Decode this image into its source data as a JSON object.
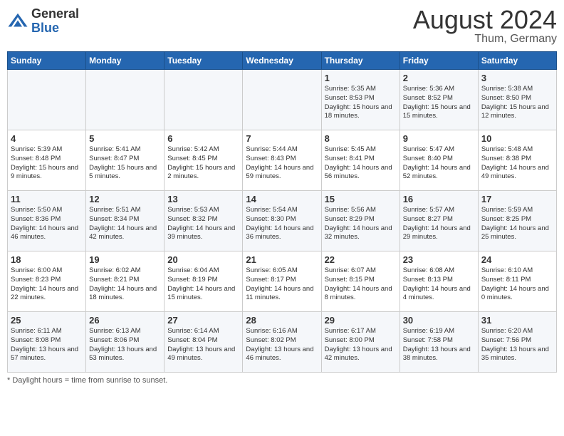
{
  "header": {
    "logo_general": "General",
    "logo_blue": "Blue",
    "month_year": "August 2024",
    "location": "Thum, Germany"
  },
  "footer": {
    "note": "Daylight hours"
  },
  "days_of_week": [
    "Sunday",
    "Monday",
    "Tuesday",
    "Wednesday",
    "Thursday",
    "Friday",
    "Saturday"
  ],
  "weeks": [
    [
      {
        "day": "",
        "detail": ""
      },
      {
        "day": "",
        "detail": ""
      },
      {
        "day": "",
        "detail": ""
      },
      {
        "day": "",
        "detail": ""
      },
      {
        "day": "1",
        "detail": "Sunrise: 5:35 AM\nSunset: 8:53 PM\nDaylight: 15 hours\nand 18 minutes."
      },
      {
        "day": "2",
        "detail": "Sunrise: 5:36 AM\nSunset: 8:52 PM\nDaylight: 15 hours\nand 15 minutes."
      },
      {
        "day": "3",
        "detail": "Sunrise: 5:38 AM\nSunset: 8:50 PM\nDaylight: 15 hours\nand 12 minutes."
      }
    ],
    [
      {
        "day": "4",
        "detail": "Sunrise: 5:39 AM\nSunset: 8:48 PM\nDaylight: 15 hours\nand 9 minutes."
      },
      {
        "day": "5",
        "detail": "Sunrise: 5:41 AM\nSunset: 8:47 PM\nDaylight: 15 hours\nand 5 minutes."
      },
      {
        "day": "6",
        "detail": "Sunrise: 5:42 AM\nSunset: 8:45 PM\nDaylight: 15 hours\nand 2 minutes."
      },
      {
        "day": "7",
        "detail": "Sunrise: 5:44 AM\nSunset: 8:43 PM\nDaylight: 14 hours\nand 59 minutes."
      },
      {
        "day": "8",
        "detail": "Sunrise: 5:45 AM\nSunset: 8:41 PM\nDaylight: 14 hours\nand 56 minutes."
      },
      {
        "day": "9",
        "detail": "Sunrise: 5:47 AM\nSunset: 8:40 PM\nDaylight: 14 hours\nand 52 minutes."
      },
      {
        "day": "10",
        "detail": "Sunrise: 5:48 AM\nSunset: 8:38 PM\nDaylight: 14 hours\nand 49 minutes."
      }
    ],
    [
      {
        "day": "11",
        "detail": "Sunrise: 5:50 AM\nSunset: 8:36 PM\nDaylight: 14 hours\nand 46 minutes."
      },
      {
        "day": "12",
        "detail": "Sunrise: 5:51 AM\nSunset: 8:34 PM\nDaylight: 14 hours\nand 42 minutes."
      },
      {
        "day": "13",
        "detail": "Sunrise: 5:53 AM\nSunset: 8:32 PM\nDaylight: 14 hours\nand 39 minutes."
      },
      {
        "day": "14",
        "detail": "Sunrise: 5:54 AM\nSunset: 8:30 PM\nDaylight: 14 hours\nand 36 minutes."
      },
      {
        "day": "15",
        "detail": "Sunrise: 5:56 AM\nSunset: 8:29 PM\nDaylight: 14 hours\nand 32 minutes."
      },
      {
        "day": "16",
        "detail": "Sunrise: 5:57 AM\nSunset: 8:27 PM\nDaylight: 14 hours\nand 29 minutes."
      },
      {
        "day": "17",
        "detail": "Sunrise: 5:59 AM\nSunset: 8:25 PM\nDaylight: 14 hours\nand 25 minutes."
      }
    ],
    [
      {
        "day": "18",
        "detail": "Sunrise: 6:00 AM\nSunset: 8:23 PM\nDaylight: 14 hours\nand 22 minutes."
      },
      {
        "day": "19",
        "detail": "Sunrise: 6:02 AM\nSunset: 8:21 PM\nDaylight: 14 hours\nand 18 minutes."
      },
      {
        "day": "20",
        "detail": "Sunrise: 6:04 AM\nSunset: 8:19 PM\nDaylight: 14 hours\nand 15 minutes."
      },
      {
        "day": "21",
        "detail": "Sunrise: 6:05 AM\nSunset: 8:17 PM\nDaylight: 14 hours\nand 11 minutes."
      },
      {
        "day": "22",
        "detail": "Sunrise: 6:07 AM\nSunset: 8:15 PM\nDaylight: 14 hours\nand 8 minutes."
      },
      {
        "day": "23",
        "detail": "Sunrise: 6:08 AM\nSunset: 8:13 PM\nDaylight: 14 hours\nand 4 minutes."
      },
      {
        "day": "24",
        "detail": "Sunrise: 6:10 AM\nSunset: 8:11 PM\nDaylight: 14 hours\nand 0 minutes."
      }
    ],
    [
      {
        "day": "25",
        "detail": "Sunrise: 6:11 AM\nSunset: 8:08 PM\nDaylight: 13 hours\nand 57 minutes."
      },
      {
        "day": "26",
        "detail": "Sunrise: 6:13 AM\nSunset: 8:06 PM\nDaylight: 13 hours\nand 53 minutes."
      },
      {
        "day": "27",
        "detail": "Sunrise: 6:14 AM\nSunset: 8:04 PM\nDaylight: 13 hours\nand 49 minutes."
      },
      {
        "day": "28",
        "detail": "Sunrise: 6:16 AM\nSunset: 8:02 PM\nDaylight: 13 hours\nand 46 minutes."
      },
      {
        "day": "29",
        "detail": "Sunrise: 6:17 AM\nSunset: 8:00 PM\nDaylight: 13 hours\nand 42 minutes."
      },
      {
        "day": "30",
        "detail": "Sunrise: 6:19 AM\nSunset: 7:58 PM\nDaylight: 13 hours\nand 38 minutes."
      },
      {
        "day": "31",
        "detail": "Sunrise: 6:20 AM\nSunset: 7:56 PM\nDaylight: 13 hours\nand 35 minutes."
      }
    ]
  ]
}
